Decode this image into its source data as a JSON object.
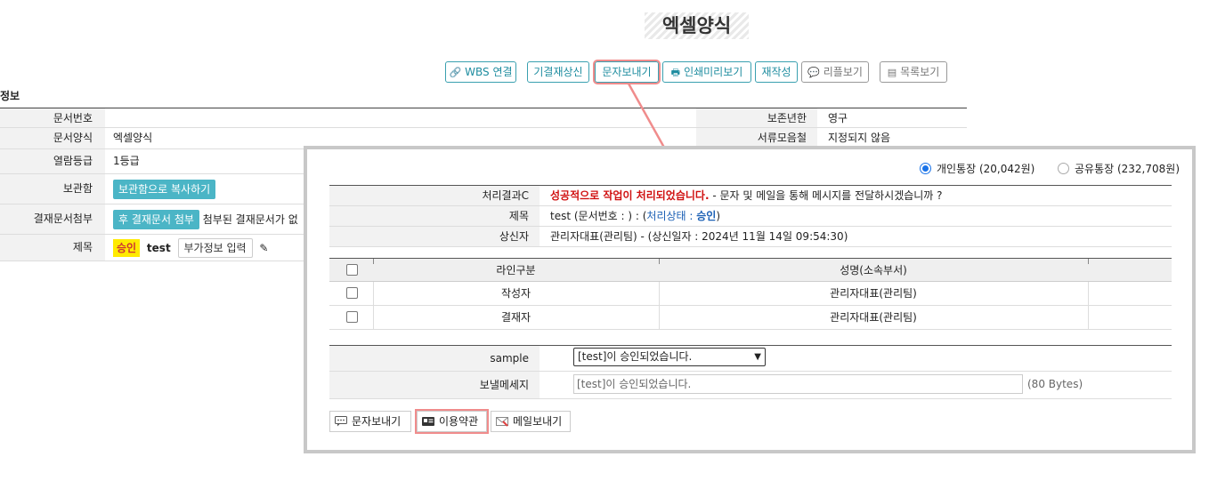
{
  "page": {
    "title": "엑셀양식"
  },
  "toolbar": {
    "wbs_label": "WBS 연결",
    "reapproval_label": "기결재상신",
    "sms_label": "문자보내기",
    "print_preview_label": "인쇄미리보기",
    "rewrite_label": "재작성",
    "reply_label": "리플보기",
    "list_label": "목록보기"
  },
  "info": {
    "section_label": "정보",
    "rows": [
      {
        "label": "문서번호",
        "value": ""
      },
      {
        "label": "문서양식",
        "value": "엑셀양식"
      },
      {
        "label": "열람등급",
        "value": "1등급"
      },
      {
        "label": "보관함",
        "button": "보관함으로 복사하기"
      },
      {
        "label": "결재문서첨부",
        "button": "후 결재문서 첨부",
        "value": "첨부된 결재문서가 없"
      },
      {
        "label": "제목",
        "badge": "승인",
        "value": "test",
        "button": "부가정보 입력"
      }
    ],
    "right_rows": [
      {
        "label": "보존년한",
        "value": "영구"
      },
      {
        "label": "서류모음철",
        "value": "지정되지 않음"
      }
    ]
  },
  "popup": {
    "account_personal": "개인통장 (20,042원)",
    "account_shared": "공유통장 (232,708원)",
    "result_label": "처리결과C",
    "result_success": "성공적으로 작업이 처리되었습니다.",
    "result_message": " - 문자 및 메일을 통해 메시지를 전달하시겠습니까 ?",
    "title_label": "제목",
    "title_value": "test (문서번호 : ) : (",
    "title_status_label": "처리상태 : ",
    "title_status": "승인",
    "title_close": ")",
    "requester_label": "상신자",
    "requester_value": "관리자대표(관리팀) - (상신일자 : 2024년 11월 14일 09:54:30)",
    "grid": {
      "col_line": "라인구분",
      "col_name": "성명(소속부서)",
      "rows": [
        {
          "line": "작성자",
          "name": "관리자대표(관리팀)"
        },
        {
          "line": "결재자",
          "name": "관리자대표(관리팀)"
        }
      ]
    },
    "sample_label": "sample",
    "sample_selected": "[test]이 승인되었습니다.",
    "message_label": "보낼메세지",
    "message_placeholder": "[test]이 승인되었습니다.",
    "message_bytes": "(80 Bytes)",
    "btn_sms": "문자보내기",
    "btn_terms": "이용약관",
    "btn_mail": "메일보내기"
  },
  "colors": {
    "accent": "#4bb5c6",
    "highlight": "#f08c8c",
    "success_red": "#d01010",
    "status_blue": "#1a5fb4"
  }
}
